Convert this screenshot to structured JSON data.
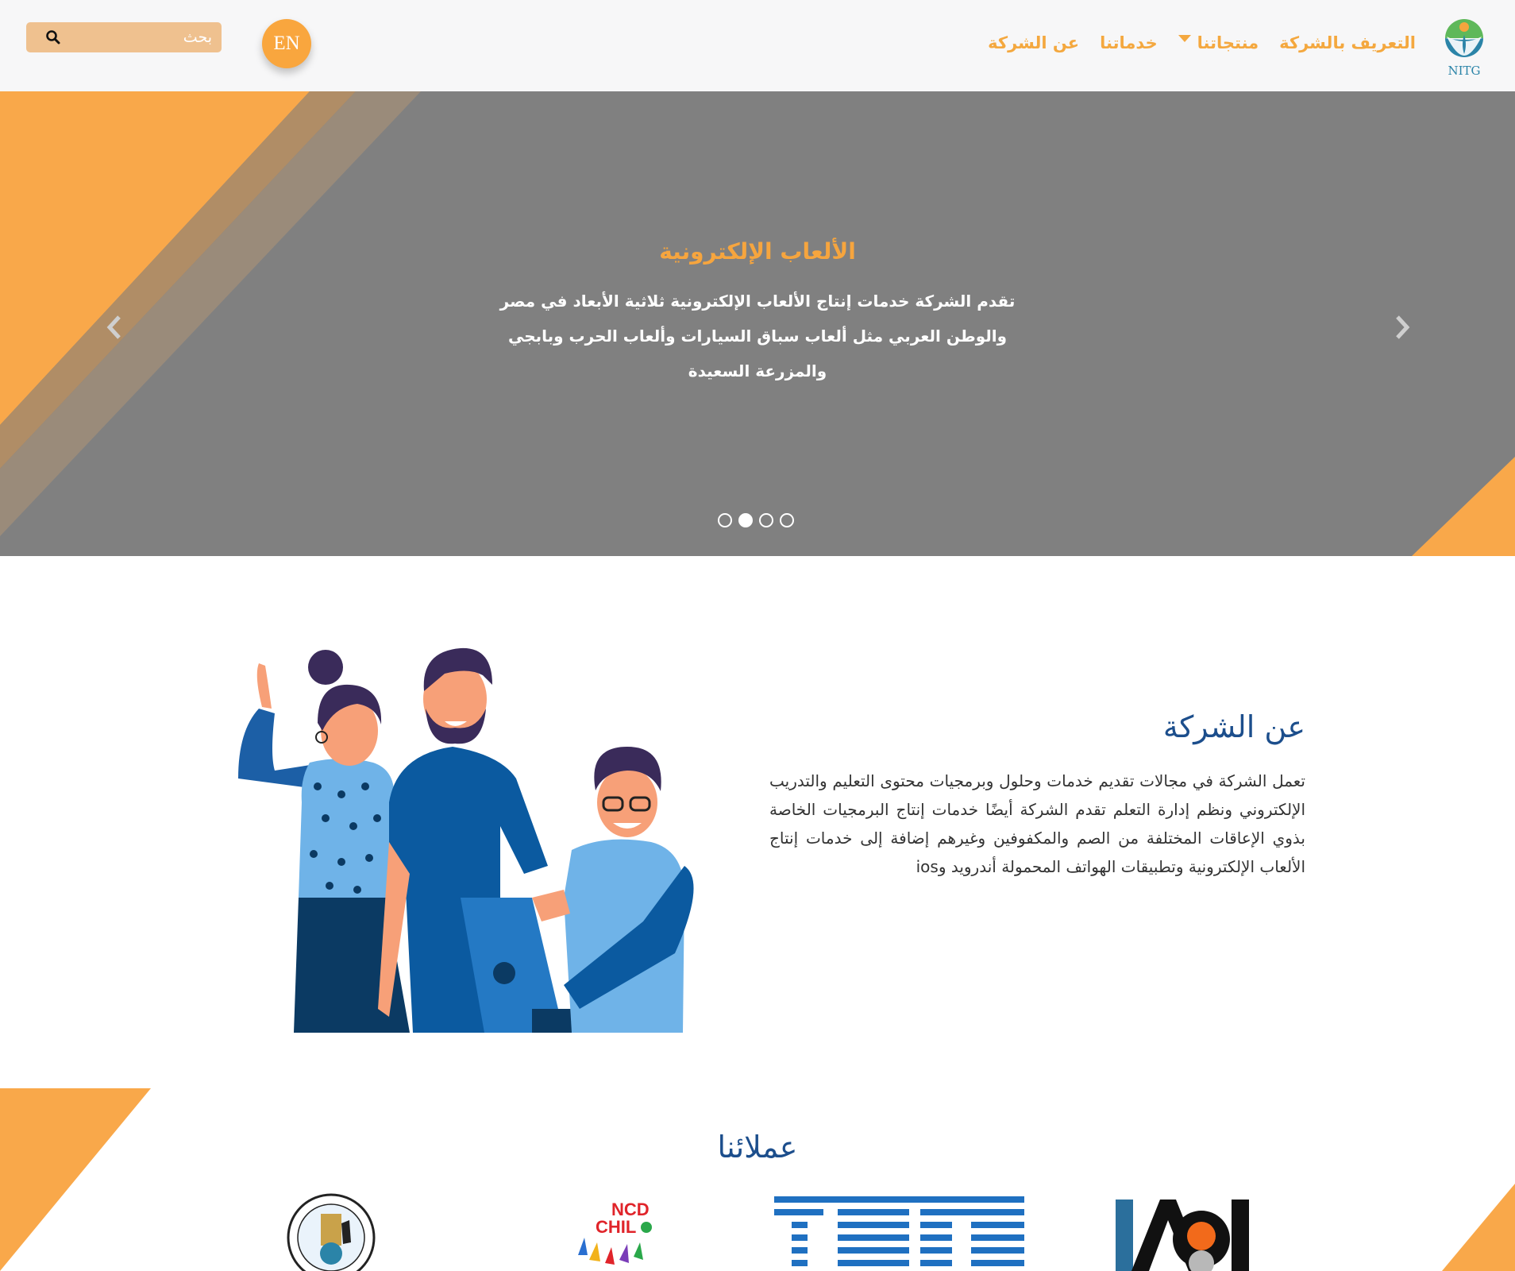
{
  "header": {
    "logo_text": "NITG",
    "nav": [
      {
        "label": "عن الشركة"
      },
      {
        "label": "خدماتنا"
      },
      {
        "label": "منتجاتنا"
      },
      {
        "label": "التعريف بالشركة"
      }
    ],
    "language_button": "EN",
    "search": {
      "placeholder": "بحث"
    }
  },
  "hero": {
    "title": "الألعاب الإلكترونية",
    "text": "تقدم الشركة خدمات إنتاج الألعاب الإلكترونية ثلاثية الأبعاد في مصر والوطن العربي مثل ألعاب سباق السيارات وألعاب الحرب وبابجي والمزرعة السعيدة",
    "slides_count": 4,
    "active_slide": 2
  },
  "about": {
    "title": "عن الشركة",
    "text": "تعمل الشركة في مجالات تقديم خدمات وحلول وبرمجيات محتوى التعليم والتدريب الإلكتروني ونظم إدارة التعلم تقدم الشركة أيضًا خدمات إنتاج البرمجيات الخاصة بذوي الإعاقات المختلفة من الصم والمكفوفين وغيرهم إضافة إلى خدمات إنتاج الألعاب الإلكترونية وتطبيقات الهواتف المحمولة أندرويد وios"
  },
  "partners": {
    "title": "عملائنا",
    "logos": [
      "AOI",
      "IBM",
      "NCD CHILD",
      "egyptian-association-seal"
    ]
  },
  "colors": {
    "accent": "#f6a53e",
    "hero_bg": "#808080",
    "heading_blue": "#1c4e8c",
    "header_bg": "#f7f7f8"
  }
}
